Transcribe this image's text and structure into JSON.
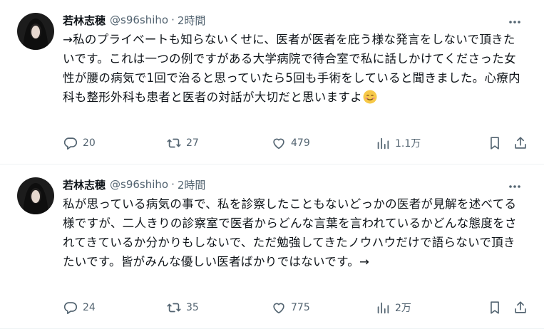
{
  "tweets": [
    {
      "author_name": "若林志穂",
      "handle": "@s96shiho",
      "separator": "·",
      "time": "2時間",
      "avatar": "profile-photo-icon",
      "text": "→私のプライベートも知らないくせに、医者が医者を庇う様な発言をしないで頂きたいです。これは一つの例ですがある大学病院で待合室で私に話しかけてくださった女性が腰の病気で1回で治ると思っていたら5回も手術をしていると聞きました。心療内科も整形外科も患者と医者の対話が大切だと思いますよ",
      "emoji": "smiling-face-icon",
      "stats": {
        "replies": "20",
        "reposts": "27",
        "likes": "479",
        "views": "1.1万"
      }
    },
    {
      "author_name": "若林志穂",
      "handle": "@s96shiho",
      "separator": "·",
      "time": "2時間",
      "avatar": "profile-photo-icon",
      "text": "私が思っている病気の事で、私を診察したこともないどっかの医者が見解を述べてる様ですが、二人きりの診察室で医者からどんな言葉を言われているかどんな態度をされてきているか分かりもしないで、ただ勉強してきたノウハウだけで語らないで頂きたいです。皆がみんな優しい医者ばかりではないです。→",
      "emoji": null,
      "stats": {
        "replies": "24",
        "reposts": "35",
        "likes": "775",
        "views": "2万"
      }
    }
  ],
  "colors": {
    "text": "#0f1419",
    "muted": "#536471",
    "divider": "#eff3f4"
  }
}
